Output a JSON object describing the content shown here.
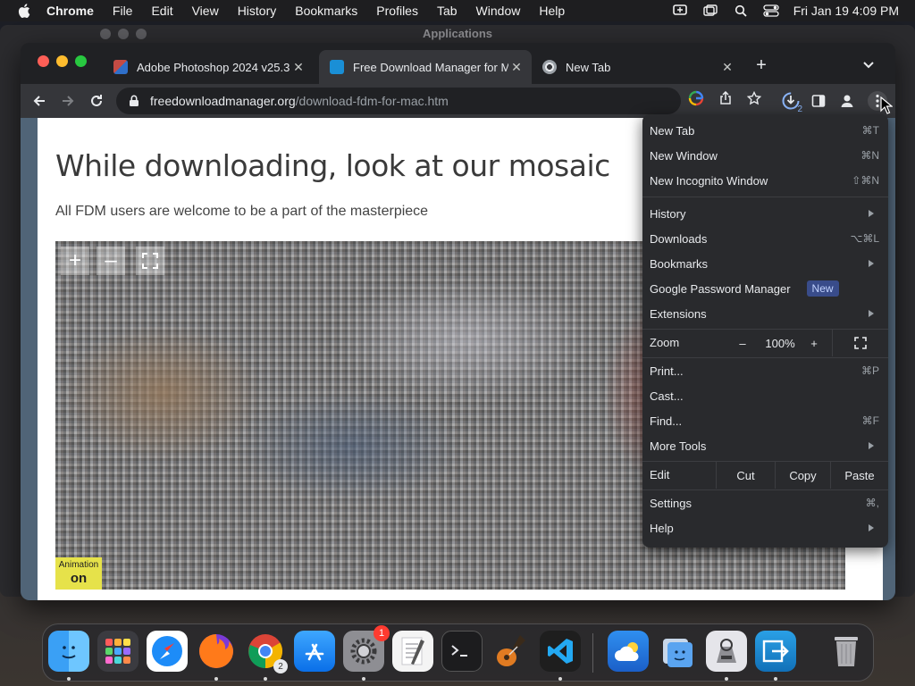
{
  "menubar": {
    "app_name": "Chrome",
    "items": [
      "File",
      "Edit",
      "View",
      "History",
      "Bookmarks",
      "Profiles",
      "Tab",
      "Window",
      "Help"
    ],
    "clock": "Fri Jan 19  4:09 PM"
  },
  "background_window": {
    "title": "Applications"
  },
  "tabs": [
    {
      "title": "Adobe Photoshop 2024 v25.3",
      "favicon_color": "#c44b44"
    },
    {
      "title": "Free Download Manager for M",
      "favicon_color": "#1a8fd6"
    },
    {
      "title": "New Tab",
      "favicon_color": "#e8eaed"
    }
  ],
  "address_bar": {
    "host": "freedownloadmanager.org",
    "path": "/download-fdm-for-mac.htm"
  },
  "toolbar": {
    "download_count": "2"
  },
  "page": {
    "heading": "While downloading, look at our mosaic",
    "subheading": "All FDM users are welcome to be a part of the masterpiece",
    "badge_line1": "Animation",
    "badge_line2": "on"
  },
  "chrome_menu": {
    "new_tab": {
      "label": "New Tab",
      "shortcut": "⌘T"
    },
    "new_window": {
      "label": "New Window",
      "shortcut": "⌘N"
    },
    "new_incognito": {
      "label": "New Incognito Window",
      "shortcut": "⇧⌘N"
    },
    "history": {
      "label": "History"
    },
    "downloads": {
      "label": "Downloads",
      "shortcut": "⌥⌘L"
    },
    "bookmarks": {
      "label": "Bookmarks"
    },
    "password_manager": {
      "label": "Google Password Manager",
      "badge": "New"
    },
    "extensions": {
      "label": "Extensions"
    },
    "zoom": {
      "label": "Zoom",
      "minus": "–",
      "value": "100%",
      "plus": "+"
    },
    "print": {
      "label": "Print...",
      "shortcut": "⌘P"
    },
    "cast": {
      "label": "Cast..."
    },
    "find": {
      "label": "Find...",
      "shortcut": "⌘F"
    },
    "more_tools": {
      "label": "More Tools"
    },
    "edit": {
      "label": "Edit",
      "cut": "Cut",
      "copy": "Copy",
      "paste": "Paste"
    },
    "settings": {
      "label": "Settings",
      "shortcut": "⌘,"
    },
    "help": {
      "label": "Help"
    }
  },
  "dock": {
    "settings_badge": "1",
    "chrome_windows": "2"
  },
  "colors": {
    "accent_new_badge": "#394c8a",
    "page_background": "#506477",
    "mosaic_badge": "#e6e24a"
  }
}
